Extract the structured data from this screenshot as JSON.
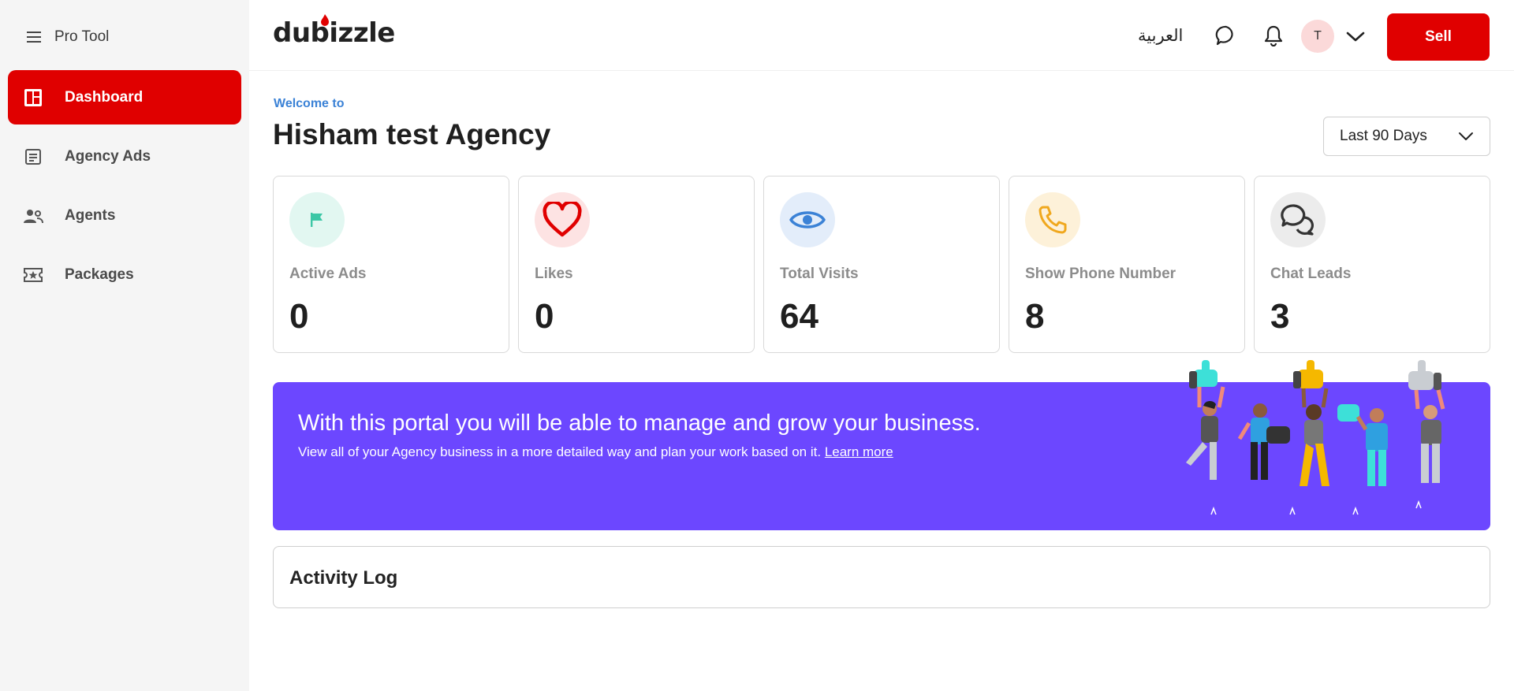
{
  "sidebar": {
    "title": "Pro Tool",
    "items": [
      {
        "label": "Dashboard",
        "icon": "dashboard-icon",
        "active": true
      },
      {
        "label": "Agency Ads",
        "icon": "document-icon",
        "active": false
      },
      {
        "label": "Agents",
        "icon": "people-icon",
        "active": false
      },
      {
        "label": "Packages",
        "icon": "ticket-star-icon",
        "active": false
      }
    ]
  },
  "header": {
    "logo": "dubizzle",
    "language_label": "العربية",
    "avatar_initial": "T",
    "sell_label": "Sell",
    "brand_color": "#e00000"
  },
  "main": {
    "welcome": "Welcome to",
    "title": "Hisham test Agency",
    "date_range": "Last 90 Days",
    "stats": [
      {
        "label": "Active Ads",
        "value": "0",
        "icon": "flag-icon",
        "icon_color": "#3cc7a6",
        "bg": "#e2f7f1"
      },
      {
        "label": "Likes",
        "value": "0",
        "icon": "heart-icon",
        "icon_color": "#e00000",
        "bg": "#fde3e3"
      },
      {
        "label": "Total Visits",
        "value": "64",
        "icon": "eye-icon",
        "icon_color": "#3b82d6",
        "bg": "#e3edfa"
      },
      {
        "label": "Show Phone Number",
        "value": "8",
        "icon": "phone-icon",
        "icon_color": "#f0a81e",
        "bg": "#fdf1d9"
      },
      {
        "label": "Chat Leads",
        "value": "3",
        "icon": "chat-bubbles-icon",
        "icon_color": "#333333",
        "bg": "#ececec"
      }
    ],
    "banner": {
      "headline": "With this portal you will be able to manage and grow your business.",
      "subline": "View all of your Agency business in a more detailed way and plan your work based on it.",
      "link": "Learn more",
      "bg": "#6c47ff"
    },
    "activity_title": "Activity Log"
  }
}
